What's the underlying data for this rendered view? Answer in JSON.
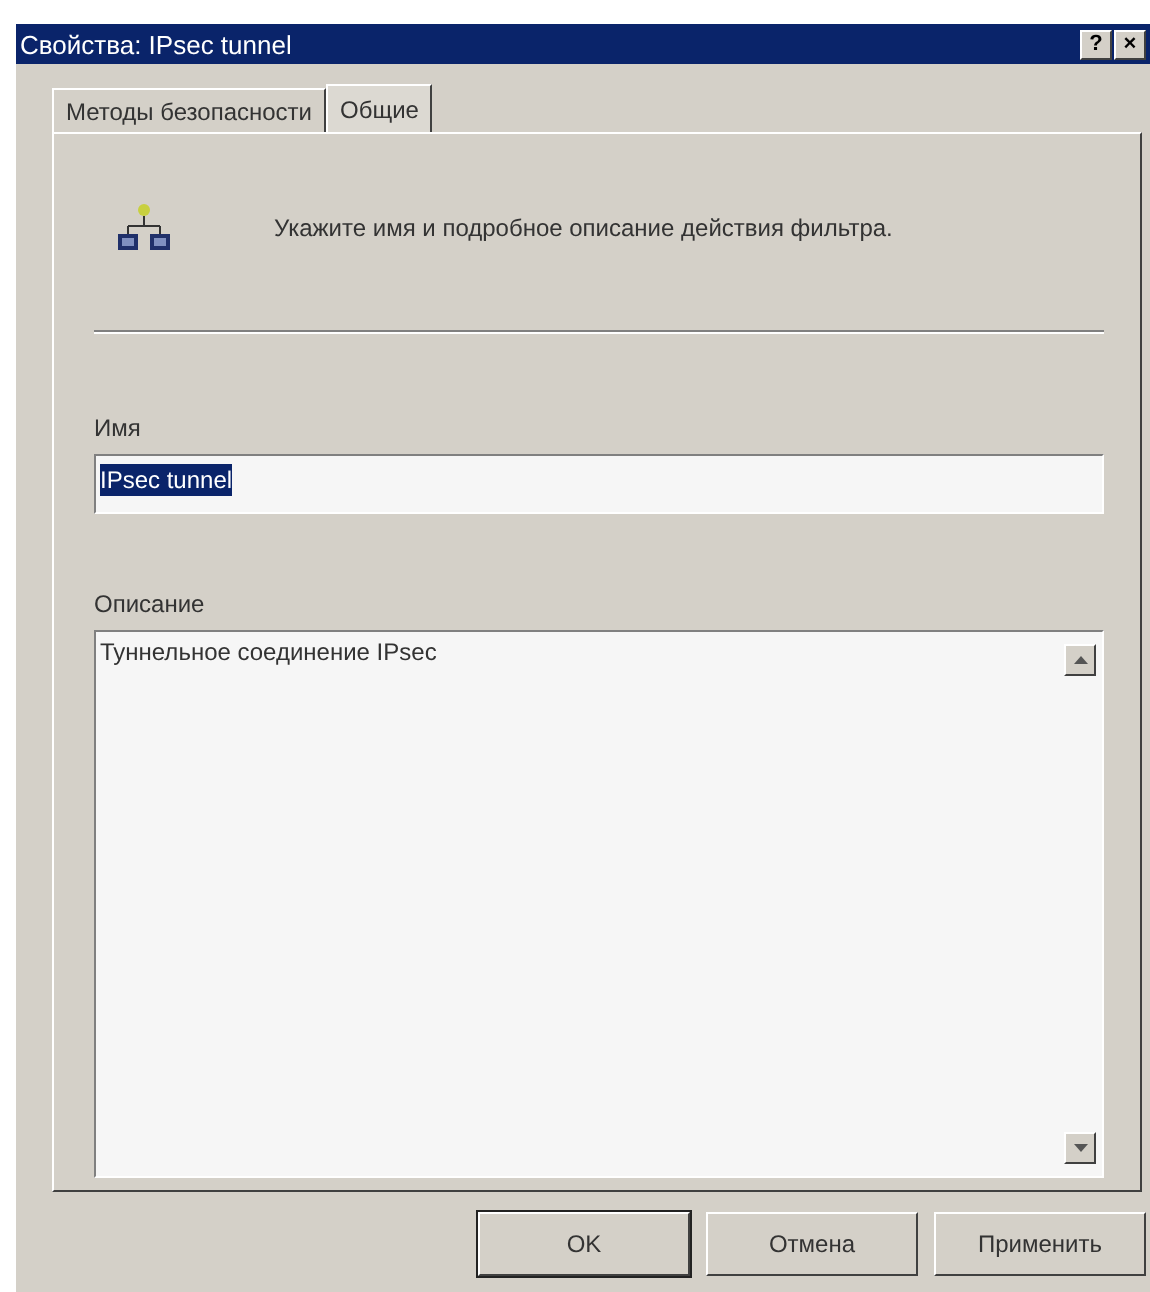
{
  "window": {
    "title": "Свойства: IPsec tunnel",
    "title_buttons": [
      "?",
      "×"
    ]
  },
  "tabs": [
    {
      "label": "Методы безопасности",
      "selected": false
    },
    {
      "label": "Общие",
      "selected": true
    }
  ],
  "intro": "Укажите имя и подробное описание действия фильтра.",
  "name_field": {
    "label": "Имя",
    "value": "IPsec tunnel"
  },
  "description_field": {
    "label": "Описание",
    "value": "Туннельное соединение IPsec"
  },
  "buttons": [
    {
      "label": "OK",
      "default": true
    },
    {
      "label": "Отмена",
      "default": false
    },
    {
      "label": "Применить",
      "default": false
    }
  ]
}
